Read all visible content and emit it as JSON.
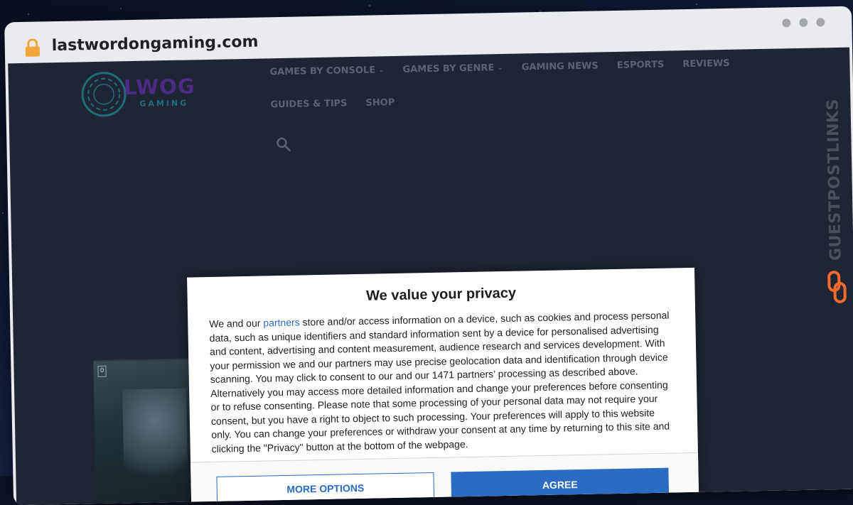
{
  "browser": {
    "url": "lastwordongaming.com"
  },
  "site": {
    "logo_text": "LWOG",
    "logo_sub": "GAMING",
    "nav": [
      {
        "label": "GAMES BY CONSOLE",
        "has_dropdown": true
      },
      {
        "label": "GAMES BY GENRE",
        "has_dropdown": true
      },
      {
        "label": "GAMING NEWS",
        "has_dropdown": false
      },
      {
        "label": "ESPORTS",
        "has_dropdown": false
      },
      {
        "label": "REVIEWS",
        "has_dropdown": false
      },
      {
        "label": "GUIDES & TIPS",
        "has_dropdown": false
      },
      {
        "label": "SHOP",
        "has_dropdown": false
      }
    ],
    "thumbnail_tag": "0"
  },
  "watermark": {
    "text": "GUESTPOSTLINKS"
  },
  "consent": {
    "title": "We value your privacy",
    "body_before_link": "We and our ",
    "link_text": "partners",
    "body_after_link": " store and/or access information on a device, such as cookies and process personal data, such as unique identifiers and standard information sent by a device for personalised advertising and content, advertising and content measurement, audience research and services development. With your permission we and our partners may use precise geolocation data and identification through device scanning. You may click to consent to our and our 1471 partners’ processing as described above. Alternatively you may access more detailed information and change your preferences before consenting or to refuse consenting. Please note that some processing of your personal data may not require your consent, but you have a right to object to such processing. Your preferences will apply to this website only. You can change your preferences or withdraw your consent at any time by returning to this site and clicking the \"Privacy\" button at the bottom of the webpage.",
    "agree_label": "AGREE",
    "more_label": "MORE OPTIONS"
  },
  "colors": {
    "page_bg": "#1f2533",
    "nav_text": "#5b6270",
    "link": "#2a6bc4",
    "logo_purple": "#4a2a83",
    "logo_teal": "#1f6c7a",
    "watermark_orange": "#f26a2e"
  },
  "icons": {
    "lock": "lock-icon",
    "search": "search-icon",
    "dropdown": "chevron-down-icon",
    "chain": "chain-link-icon"
  }
}
